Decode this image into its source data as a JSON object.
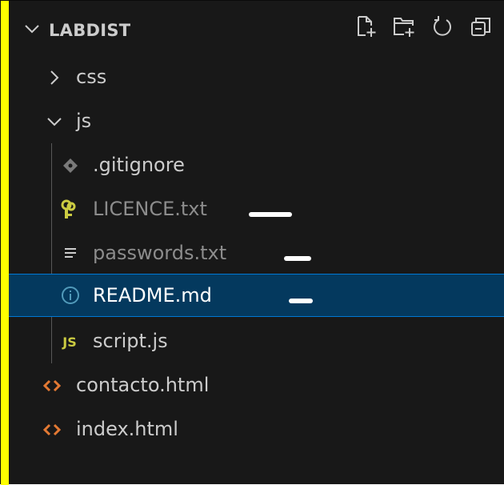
{
  "explorer": {
    "title": "LABDIST",
    "actions": [
      {
        "name": "new-file-icon",
        "label": "New File"
      },
      {
        "name": "new-folder-icon",
        "label": "New Folder"
      },
      {
        "name": "refresh-icon",
        "label": "Refresh Explorer"
      },
      {
        "name": "collapse-all-icon",
        "label": "Collapse Folders in Explorer"
      }
    ],
    "items": [
      {
        "label": "css",
        "type": "folder",
        "expanded": false,
        "icon": "chevron-right-icon"
      },
      {
        "label": "js",
        "type": "folder",
        "expanded": true,
        "icon": "chevron-down-icon"
      },
      {
        "label": ".gitignore",
        "type": "file",
        "icon": "git-icon",
        "dimmed": false
      },
      {
        "label": "LICENCE.txt",
        "type": "file",
        "icon": "license-key-icon",
        "dimmed": true
      },
      {
        "label": "passwords.txt",
        "type": "file",
        "icon": "text-file-icon",
        "dimmed": true
      },
      {
        "label": "README.md",
        "type": "file",
        "icon": "info-icon",
        "selected": true
      },
      {
        "label": "script.js",
        "type": "file",
        "icon": "js-icon",
        "icon_text": "JS"
      },
      {
        "label": "contacto.html",
        "type": "file",
        "icon": "html-icon"
      },
      {
        "label": "index.html",
        "type": "file",
        "icon": "html-icon"
      }
    ]
  },
  "colors": {
    "background": "#181818",
    "text": "#cccccc",
    "dimmed_text": "#8c8c8c",
    "selection": "#04395e",
    "selection_border": "#0078d4",
    "html_icon": "#e37933",
    "js_icon": "#cbcb41",
    "info_icon": "#519aba",
    "license_icon": "#cbcb41",
    "accent_strip": "#ffff00"
  }
}
